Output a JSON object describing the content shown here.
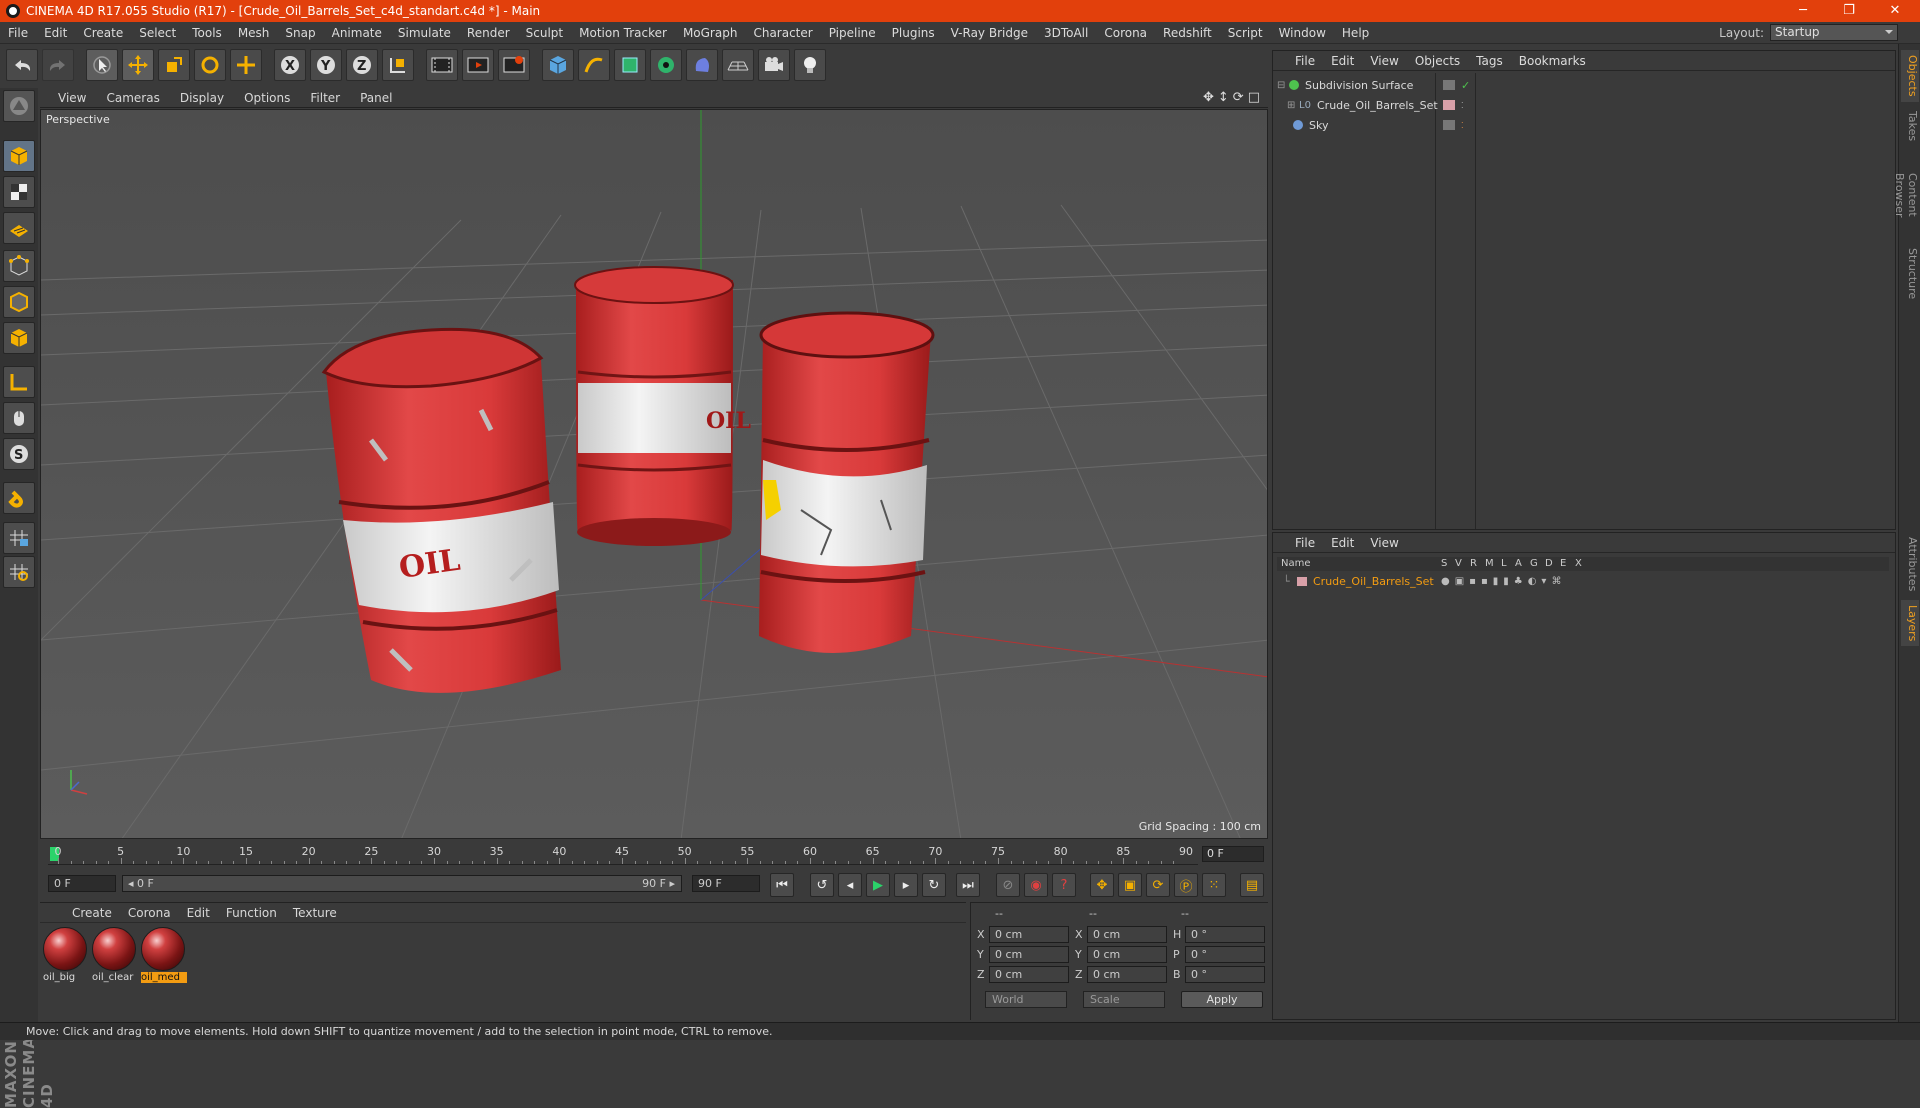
{
  "window": {
    "title": "CINEMA 4D R17.055 Studio (R17) - [Crude_Oil_Barrels_Set_c4d_standart.c4d *] - Main",
    "minimize": "─",
    "restore": "❐",
    "close": "✕"
  },
  "menu": [
    "File",
    "Edit",
    "Create",
    "Select",
    "Tools",
    "Mesh",
    "Snap",
    "Animate",
    "Simulate",
    "Render",
    "Sculpt",
    "Motion Tracker",
    "MoGraph",
    "Character",
    "Pipeline",
    "Plugins",
    "V-Ray Bridge",
    "3DToAll",
    "Corona",
    "Redshift",
    "Script",
    "Window",
    "Help"
  ],
  "layout": {
    "label": "Layout:",
    "value": "Startup"
  },
  "viewport": {
    "menu": [
      "View",
      "Cameras",
      "Display",
      "Options",
      "Filter",
      "Panel"
    ],
    "camera_label": "Perspective",
    "grid_spacing": "Grid Spacing : 100 cm",
    "nav_icons": [
      "✥",
      "↕",
      "⟳",
      "□"
    ]
  },
  "timeline": {
    "ticks": [
      "0",
      "5",
      "10",
      "15",
      "20",
      "25",
      "30",
      "35",
      "40",
      "45",
      "50",
      "55",
      "60",
      "65",
      "70",
      "75",
      "80",
      "85",
      "90"
    ],
    "current_frame": "0 F"
  },
  "transport": {
    "start": "0 F",
    "range_start": "◂ 0 F",
    "range_end": "90 F ▸",
    "end": "90 F"
  },
  "materials": {
    "menu": [
      "Create",
      "Corona",
      "Edit",
      "Function",
      "Texture"
    ],
    "items": [
      {
        "label": "oil_big",
        "selected": false
      },
      {
        "label": "oil_clear",
        "selected": false
      },
      {
        "label": "oil_med",
        "selected": true
      }
    ]
  },
  "coords": {
    "headers": [
      "--",
      "--",
      "--"
    ],
    "rows": [
      {
        "a": "X",
        "v1": "0 cm",
        "b": "X",
        "v2": "0 cm",
        "c": "H",
        "v3": "0 °"
      },
      {
        "a": "Y",
        "v1": "0 cm",
        "b": "Y",
        "v2": "0 cm",
        "c": "P",
        "v3": "0 °"
      },
      {
        "a": "Z",
        "v1": "0 cm",
        "b": "Z",
        "v2": "0 cm",
        "c": "B",
        "v3": "0 °"
      }
    ],
    "world": "World",
    "scale": "Scale",
    "apply": "Apply"
  },
  "objects": {
    "menu": [
      "File",
      "Edit",
      "View",
      "Objects",
      "Tags",
      "Bookmarks"
    ],
    "rows": [
      {
        "name": "Subdivision Surface",
        "color": "#4ec24e"
      },
      {
        "name": "Crude_Oil_Barrels_Set",
        "color": "#bdbdbd"
      },
      {
        "name": "Sky",
        "color": "#6f9ad6"
      }
    ]
  },
  "layers": {
    "menu": [
      "File",
      "Edit",
      "View"
    ],
    "columns": [
      "Name",
      "S",
      "V",
      "R",
      "M",
      "L",
      "A",
      "G",
      "D",
      "E",
      "X"
    ],
    "rows": [
      {
        "name": "Crude_Oil_Barrels_Set",
        "color": "#f39c12"
      }
    ]
  },
  "right_tabs": [
    "Objects",
    "Takes",
    "Content Browser",
    "Structure",
    "Attributes",
    "Layers"
  ],
  "status": "Move: Click and drag to move elements. Hold down SHIFT to quantize movement / add to the selection in point mode, CTRL to remove.",
  "branding": "MAXON CINEMA 4D",
  "barrel_text": [
    "OIL",
    "OIL"
  ]
}
